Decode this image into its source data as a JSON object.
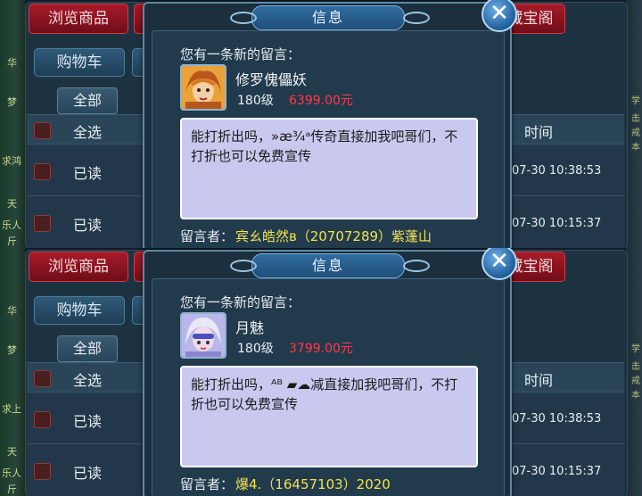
{
  "panels": [
    {
      "side_chars": [
        "华",
        "梦",
        "求鸿",
        "天",
        "乐人",
        "斤"
      ],
      "right_chars": [
        "学",
        "击",
        "戒",
        "本"
      ],
      "browse_button": "浏览商品",
      "treasure_button": "藏宝阁",
      "cart_button": "购物车",
      "all_tab": "全部",
      "table": {
        "select_all": "全选",
        "time_header": "时间",
        "rows": [
          {
            "status": "已读",
            "time": "07-30 10:38:53"
          },
          {
            "status": "已读",
            "time": "07-30 10:15:37"
          }
        ]
      },
      "dialog": {
        "title": "信息",
        "close_symbol": "✕",
        "new_message": "您有一条新的留言：",
        "seller_name": "修罗傀儡妖",
        "level": "180级",
        "price": "6399.00元",
        "message": "能打折出吗，»æ¾ᵃ传奇直接加我吧哥们，不打折也可以免费宣传",
        "footer_label": "留言者：",
        "footer_value": "宾ㄠ皓然ʙ（20707289）紫蓬山"
      }
    },
    {
      "side_chars": [
        "华",
        "梦",
        "求上",
        "天",
        "乐人",
        "斤"
      ],
      "right_chars": [
        "学",
        "击",
        "戒",
        "本"
      ],
      "browse_button": "浏览商品",
      "treasure_button": "藏宝阁",
      "cart_button": "购物车",
      "all_tab": "全部",
      "table": {
        "select_all": "全选",
        "time_header": "时间",
        "rows": [
          {
            "status": "已读",
            "time": "07-30 10:38:53"
          },
          {
            "status": "已读",
            "time": "07-30 10:15:37"
          }
        ]
      },
      "dialog": {
        "title": "信息",
        "close_symbol": "✕",
        "new_message": "您有一条新的留言：",
        "seller_name": "月魅",
        "level": "180级",
        "price": "3799.00元",
        "message": "能打折出吗，ᴬᴮ ▰☁减直接加我吧哥们，不打折也可以免费宣传",
        "footer_label": "留言者：",
        "footer_value": "爆4.（16457103）2020"
      }
    }
  ],
  "colors": {
    "accent_red": "#a81a2a",
    "price_red": "#ff3a4a",
    "footer_yellow": "#f4e24c",
    "message_bg": "#c9c8ee"
  },
  "icons": {
    "avatar_1": "demon-portrait-icon",
    "avatar_2": "fairy-portrait-icon",
    "close": "close-icon"
  }
}
